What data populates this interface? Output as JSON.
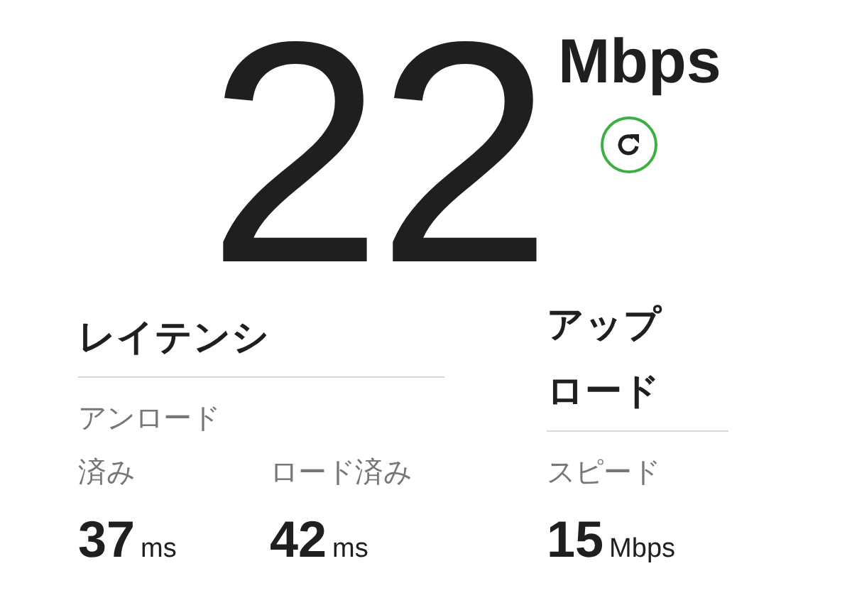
{
  "speed": {
    "value": "22",
    "unit": "Mbps"
  },
  "latency": {
    "title": "レイテンシ",
    "metrics": [
      {
        "label": "アンロード済み",
        "value": "37",
        "unit": "ms"
      },
      {
        "label": "ロード済み",
        "value": "42",
        "unit": "ms"
      }
    ]
  },
  "upload": {
    "title": "アップロード",
    "metrics": [
      {
        "label": "スピード",
        "value": "15",
        "unit": "Mbps"
      }
    ]
  }
}
